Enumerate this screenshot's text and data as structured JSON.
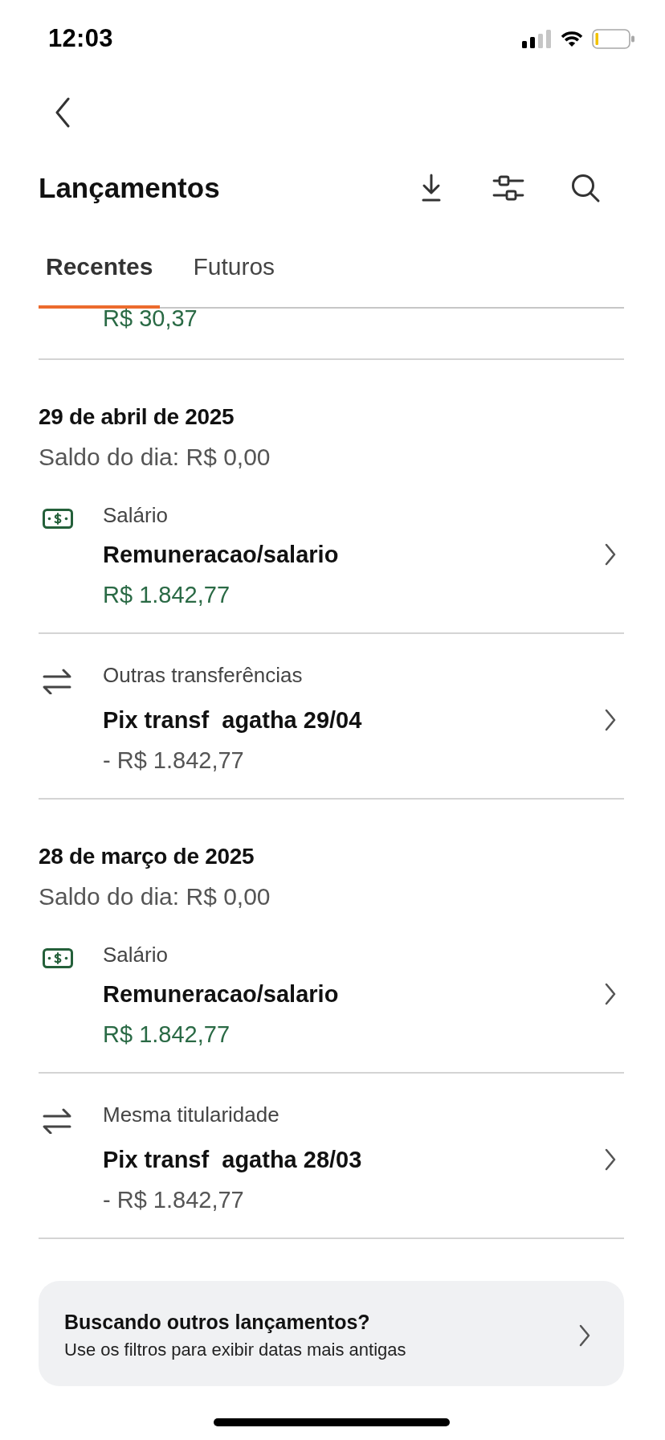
{
  "status_bar": {
    "time": "12:03"
  },
  "header": {
    "title": "Lançamentos"
  },
  "tabs": [
    {
      "label": "Recentes",
      "selected": true
    },
    {
      "label": "Futuros",
      "selected": false
    }
  ],
  "previous_entry": {
    "amount": "R$ 30,37",
    "credit": true
  },
  "days": [
    {
      "date": "29 de abril de 2025",
      "balance": "Saldo do dia: R$ 0,00",
      "transactions": [
        {
          "kind": "salary",
          "category": "Salário",
          "title": "Remuneracao/salario",
          "amount": "R$ 1.842,77",
          "credit": true
        },
        {
          "kind": "transfer",
          "category": "Outras transferências",
          "title": "Pix transf  agatha 29/04",
          "amount": "- R$ 1.842,77",
          "credit": false
        }
      ]
    },
    {
      "date": "28 de março de 2025",
      "balance": "Saldo do dia: R$ 0,00",
      "transactions": [
        {
          "kind": "salary",
          "category": "Salário",
          "title": "Remuneracao/salario",
          "amount": "R$ 1.842,77",
          "credit": true
        },
        {
          "kind": "transfer",
          "category": "Mesma titularidade",
          "title": "Pix transf  agatha 28/03",
          "amount": "- R$ 1.842,77",
          "credit": false
        }
      ]
    }
  ],
  "more_card": {
    "title": "Buscando outros lançamentos?",
    "subtitle": "Use os filtros para exibir datas mais antigas"
  }
}
